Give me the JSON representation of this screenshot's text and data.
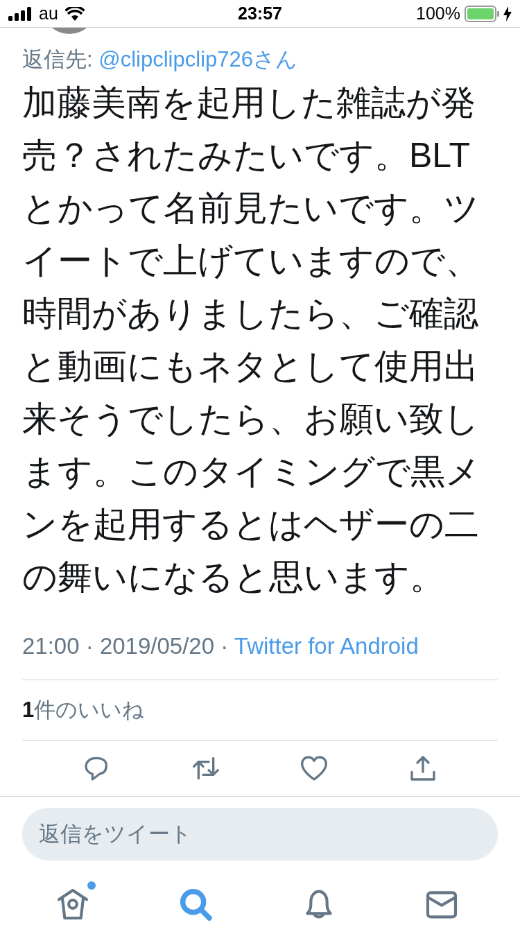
{
  "status_bar": {
    "carrier": "au",
    "time": "23:57",
    "battery": "100%",
    "charging": true
  },
  "tweet": {
    "reply_to_label": "返信先:",
    "reply_to_handle": "@clipclipclip726さん",
    "text": "加藤美南を起用した雑誌が発売？されたみたいです。BLTとかって名前見たいです。ツイートで上げていますので、時間がありましたら、ご確認と動画にもネタとして使用出来そうでしたら、お願い致します。このタイミングで黒メンを起用するとはヘザーの二の舞いになると思います。",
    "meta": "21:00 · 2019/05/20 ·",
    "source": "Twitter for Android",
    "likes": "**1**件のいいね",
    "actions": [
      {
        "kind": "reply"
      },
      {
        "kind": "retweet"
      },
      {
        "kind": "like"
      },
      {
        "kind": "share"
      }
    ]
  },
  "reply_field": {
    "placeholder": "返信をツイート"
  },
  "tab_bar": [
    {
      "kind": "home",
      "selected": false,
      "dot": true
    },
    {
      "kind": "search",
      "selected": true,
      "dot": false
    },
    {
      "kind": "notifications",
      "selected": false,
      "dot": false
    },
    {
      "kind": "messages",
      "selected": false,
      "dot": false
    }
  ]
}
